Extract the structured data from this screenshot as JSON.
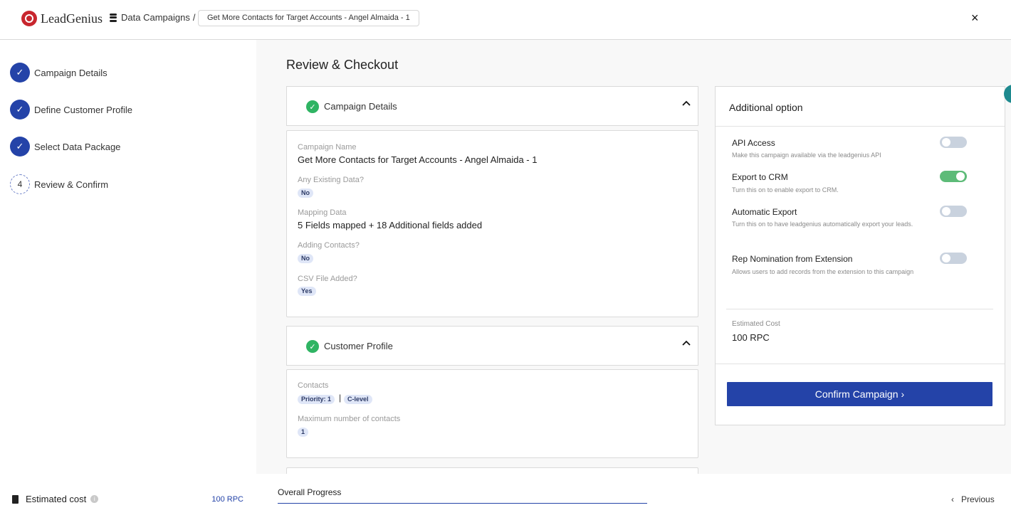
{
  "header": {
    "logo_text": "LeadGenius",
    "breadcrumb_root": "Data Campaigns",
    "breadcrumb_separator": "/",
    "breadcrumb_current": "Get More Contacts for Target Accounts - Angel Almaida - 1",
    "close_symbol": "×"
  },
  "sidebar": {
    "steps": [
      {
        "label": "Campaign Details",
        "status": "complete",
        "marker": "✓"
      },
      {
        "label": "Define Customer Profile",
        "status": "complete",
        "marker": "✓"
      },
      {
        "label": "Select Data Package",
        "status": "complete",
        "marker": "✓"
      },
      {
        "label": "Review & Confirm",
        "status": "current",
        "marker": "4"
      }
    ],
    "estimated_cost_label": "Estimated cost",
    "estimated_cost_value": "100 RPC"
  },
  "main": {
    "title": "Review & Checkout",
    "campaign_details": {
      "title": "Campaign Details",
      "campaign_name_label": "Campaign Name",
      "campaign_name_value": "Get More Contacts for Target Accounts - Angel Almaida - 1",
      "existing_data_label": "Any Existing Data?",
      "existing_data_value": "No",
      "mapping_label": "Mapping Data",
      "mapping_value": "5 Fields mapped + 18 Additional fields added",
      "adding_contacts_label": "Adding Contacts?",
      "adding_contacts_value": "No",
      "csv_label": "CSV File Added?",
      "csv_value": "Yes"
    },
    "customer_profile": {
      "title": "Customer Profile",
      "contacts_label": "Contacts",
      "contacts_priority": "Priority: 1",
      "contacts_separator": "|",
      "contacts_level": "C-level",
      "max_contacts_label": "Maximum number of contacts",
      "max_contacts_value": "1"
    }
  },
  "panel": {
    "title": "Additional option",
    "options": [
      {
        "label": "API Access",
        "desc": "Make this campaign available via the leadgenius API",
        "enabled": false
      },
      {
        "label": "Export to CRM",
        "desc": "Turn this on to enable export to CRM.",
        "enabled": true
      },
      {
        "label": "Automatic Export",
        "desc": "Turn this on to have leadgenius automatically export your leads.",
        "enabled": false
      },
      {
        "label": "Rep Nomination from Extension",
        "desc": "Allows users to add records from the extension to this campaign",
        "enabled": false
      }
    ],
    "estimated_cost_label": "Estimated Cost",
    "estimated_cost_value": "100 RPC",
    "confirm_label": "Confirm Campaign",
    "confirm_arrow": "›"
  },
  "footer": {
    "progress_label": "Overall Progress",
    "previous_label": "Previous",
    "previous_arrow": "‹"
  },
  "colors": {
    "primary": "#2443a8",
    "success": "#2fb463",
    "toggle_on": "#5dbb78",
    "toggle_off": "#c9d2de",
    "brand": "#c8262e"
  }
}
